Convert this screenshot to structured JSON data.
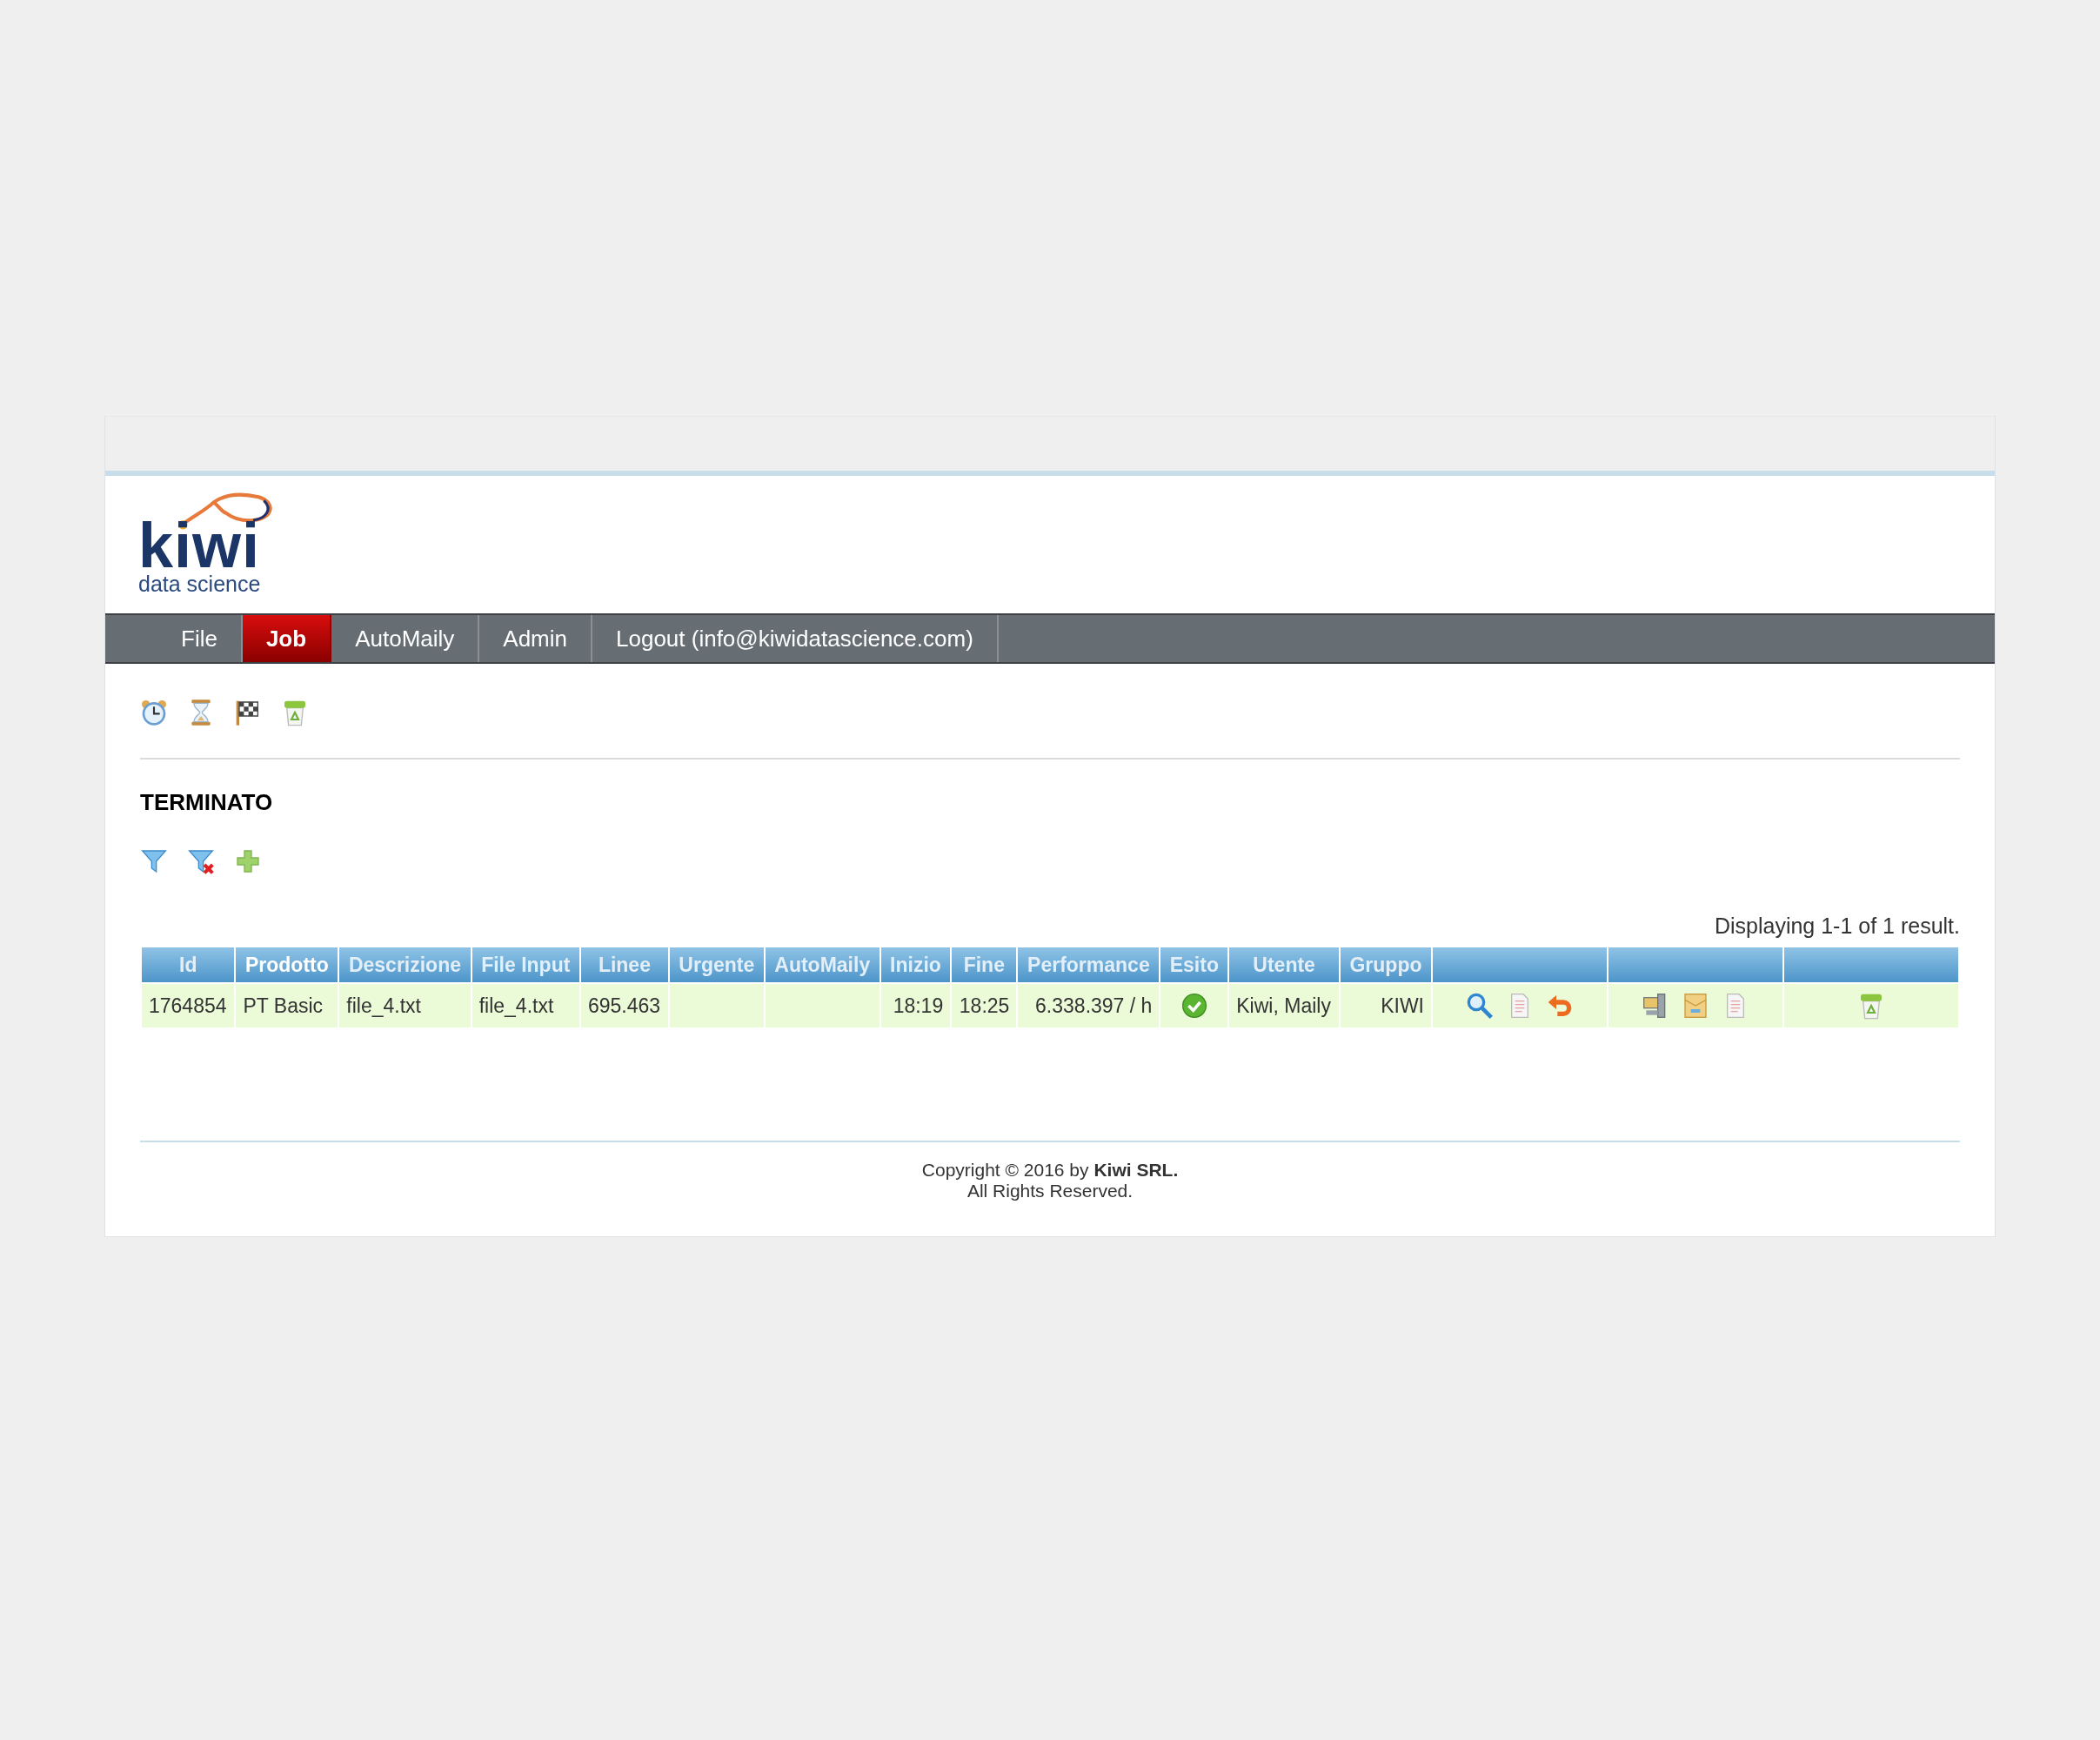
{
  "logo": {
    "wordmark": "kiwi",
    "tagline": "data science"
  },
  "nav": [
    {
      "label": "File",
      "selected": false
    },
    {
      "label": "Job",
      "selected": true
    },
    {
      "label": "AutoMaily",
      "selected": false
    },
    {
      "label": "Admin",
      "selected": false
    },
    {
      "label": "Logout (info@kiwidatascience.com)",
      "selected": false
    }
  ],
  "toolbar": [
    {
      "kind": "alarm-clock"
    },
    {
      "kind": "hourglass"
    },
    {
      "kind": "flag"
    },
    {
      "kind": "recycle-bin"
    }
  ],
  "section_title": "TERMINATO",
  "filters": [
    {
      "kind": "filter"
    },
    {
      "kind": "filter-remove"
    },
    {
      "kind": "plus"
    }
  ],
  "result_summary": "Displaying 1-1 of 1 result.",
  "table": {
    "columns": [
      {
        "label": "Id",
        "sorted": false
      },
      {
        "label": "Prodotto",
        "sorted": true
      },
      {
        "label": "Descrizione",
        "sorted": false
      },
      {
        "label": "File Input",
        "sorted": false
      },
      {
        "label": "Linee",
        "sorted": false
      },
      {
        "label": "Urgente",
        "sorted": false
      },
      {
        "label": "AutoMaily",
        "sorted": false
      },
      {
        "label": "Inizio",
        "sorted": false
      },
      {
        "label": "Fine",
        "sorted": false
      },
      {
        "label": "Performance",
        "sorted": false
      },
      {
        "label": "Esito",
        "sorted": false
      },
      {
        "label": "Utente",
        "sorted": false
      },
      {
        "label": "Gruppo",
        "sorted": false
      },
      {
        "kind": "actions"
      },
      {
        "kind": "actions"
      },
      {
        "kind": "actions"
      }
    ],
    "rows": [
      {
        "cells": [
          {
            "kind": "text",
            "text": "1764854"
          },
          {
            "kind": "text",
            "text": "PT Basic"
          },
          {
            "kind": "text",
            "text": "file_4.txt"
          },
          {
            "kind": "text",
            "text": "file_4.txt"
          },
          {
            "kind": "text",
            "text": "695.463"
          },
          {
            "kind": "empty"
          },
          {
            "kind": "empty"
          },
          {
            "kind": "text",
            "text": "18:19"
          },
          {
            "kind": "text",
            "text": "18:25"
          },
          {
            "kind": "text",
            "text": "6.338.397 / h"
          },
          {
            "kind": "icons",
            "icons": [
              {
                "kind": "check"
              }
            ]
          },
          {
            "kind": "text",
            "text": "Kiwi, Maily"
          },
          {
            "kind": "text",
            "text": "KIWI"
          },
          {
            "kind": "icons",
            "icons": [
              {
                "kind": "magnifier"
              },
              {
                "kind": "document"
              },
              {
                "kind": "undo"
              }
            ]
          },
          {
            "kind": "icons",
            "icons": [
              {
                "kind": "server"
              },
              {
                "kind": "envelope"
              },
              {
                "kind": "document"
              }
            ]
          },
          {
            "kind": "icons",
            "icons": [
              {
                "kind": "recycle-bin"
              }
            ]
          }
        ]
      }
    ]
  },
  "footer": {
    "copyright": "Copyright © 2016 by **Kiwi SRL.**",
    "rights": "All Rights Reserved."
  }
}
